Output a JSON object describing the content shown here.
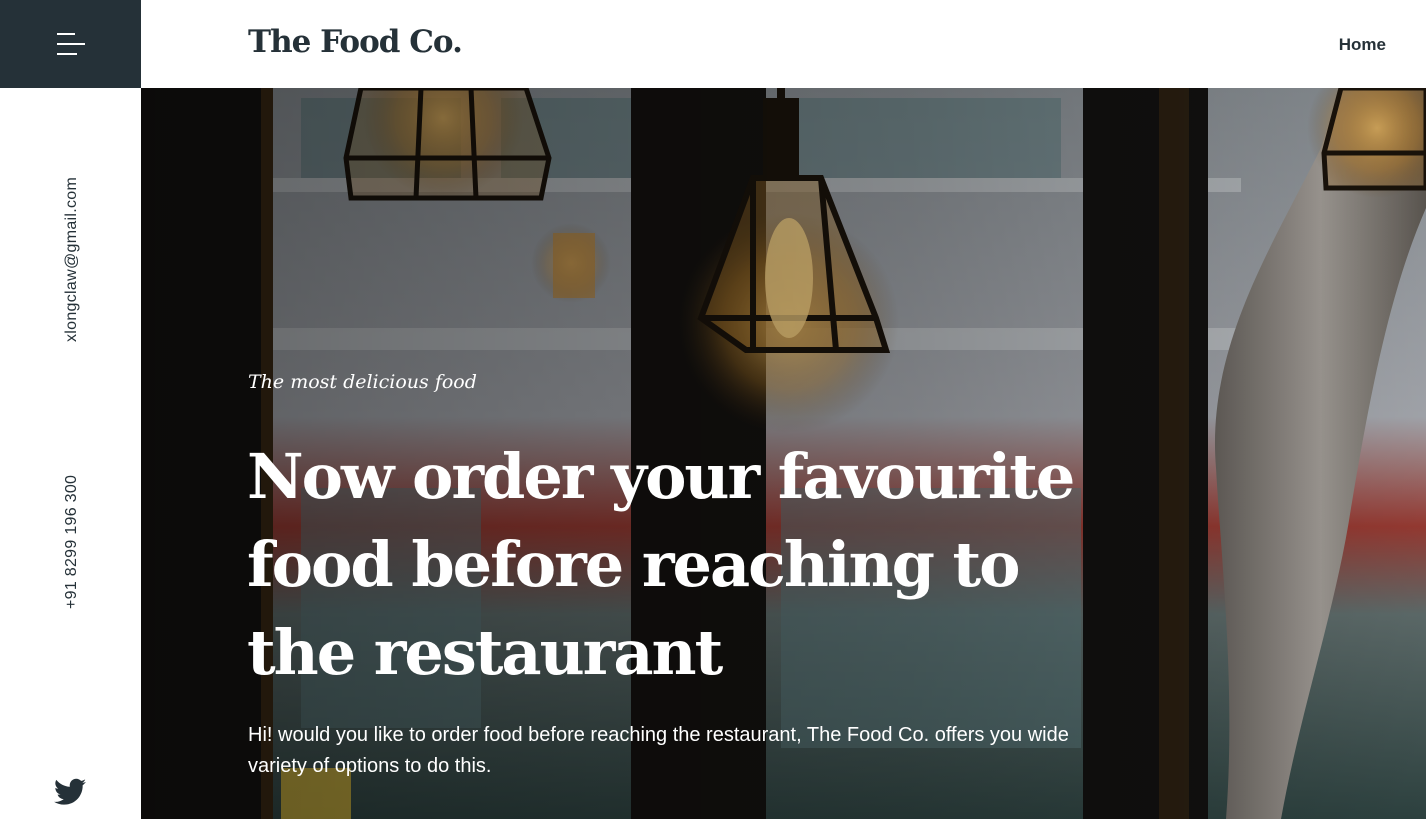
{
  "sidebar": {
    "email": "xlongclaw@gmail.com",
    "phone": "+91 8299 196 300"
  },
  "header": {
    "brand": "The Food Co.",
    "nav": {
      "home": "Home"
    }
  },
  "hero": {
    "tagline": "The most delicious food",
    "headline": "Now order your favourite food before reaching to the restaurant",
    "description": "Hi! would you like to order food before reaching the restaurant, The Food Co. offers you wide variety of options to do this."
  },
  "colors": {
    "dark": "#253138",
    "white": "#ffffff"
  },
  "icons": [
    "menu-icon",
    "twitter-icon"
  ]
}
